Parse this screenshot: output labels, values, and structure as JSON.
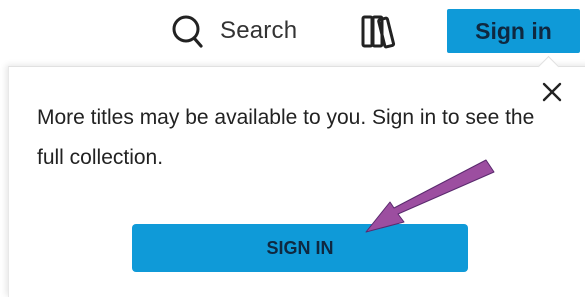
{
  "header": {
    "search_label": "Search",
    "search_icon": "search-icon",
    "library_icon": "library-books-icon",
    "signin_label": "Sign in"
  },
  "popup": {
    "message": "More titles may be available to you. Sign in to see the full collection.",
    "close_icon": "close-icon",
    "signin_label": "SIGN IN"
  },
  "colors": {
    "accent": "#0f9ad8",
    "button_text": "#0f2840",
    "annotation_arrow": "#9c4ea0"
  }
}
